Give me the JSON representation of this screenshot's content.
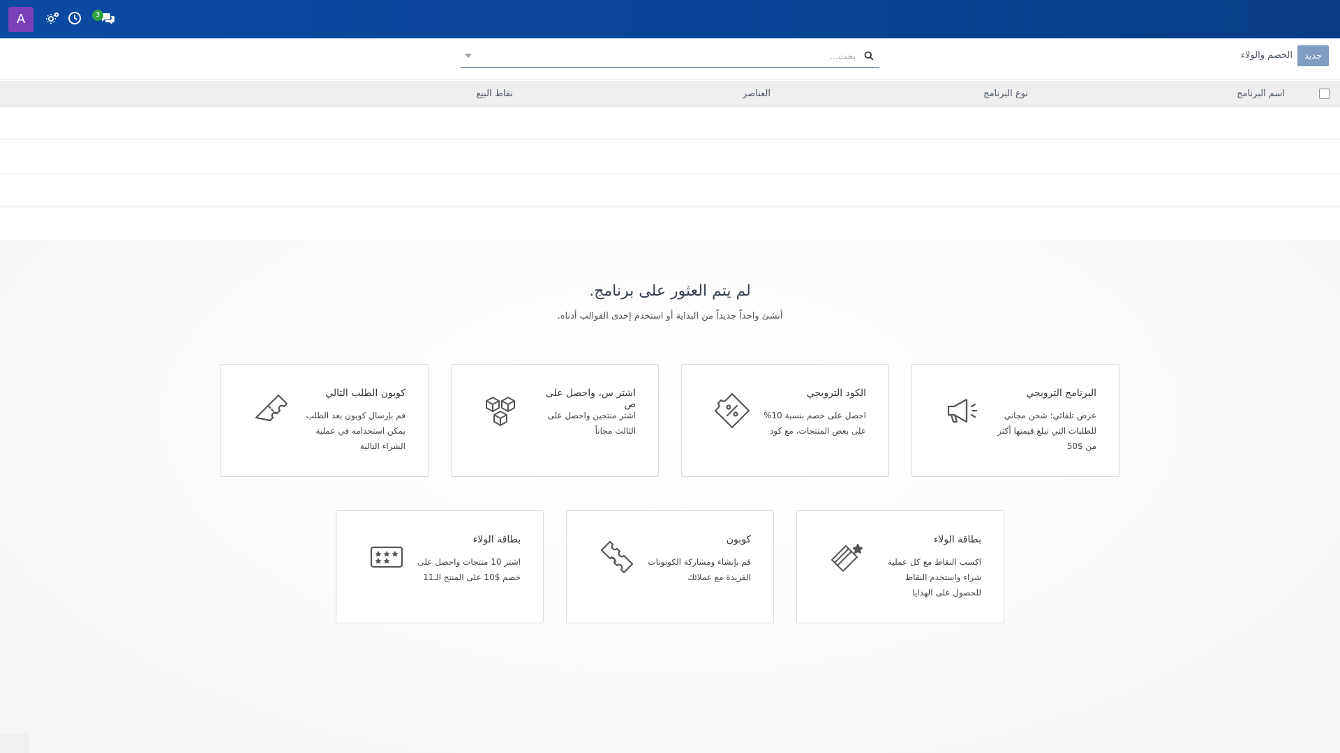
{
  "topbar": {
    "avatar_letter": "A",
    "chat_badge_count": "3",
    "icons": [
      "settings-icon",
      "clock-icon",
      "chat-icon"
    ]
  },
  "control": {
    "new_button": "جديد",
    "breadcrumb": "الخصم والولاء",
    "search_placeholder": "بحث..."
  },
  "list": {
    "columns": [
      "اسم البرنامج",
      "نوع البرنامج",
      "العناصر",
      "نقاط البيع"
    ]
  },
  "empty_state": {
    "title": "لم يتم العثور على برنامج.",
    "subtitle": "أنشئ واحداً جديداً من البداية أو استخدم إحدى القوالب أدناه."
  },
  "templates": [
    {
      "title": "البرنامج الترويجي",
      "description": "عرض تلقائي: شحن مجاني للطلبات التي تبلغ قيمتها أكثر من $50",
      "icon": "megaphone-icon"
    },
    {
      "title": "الكود الترويجي",
      "description": "احصل على خصم بنسبة 10% على بعض المنتجات، مع كود",
      "icon": "discount-tag-icon"
    },
    {
      "title": "اشتر س، واحصل على ص",
      "description": "اشتر منتجين واحصل على الثالث مجاناً",
      "icon": "boxes-icon"
    },
    {
      "title": "كوبون الطلب التالي",
      "description": "قم بإرسال كوبون بعد الطلب يمكن استخدامه في عملية الشراء التالية",
      "icon": "ticket-icon"
    },
    {
      "title": "بطاقة الولاء",
      "description": "اكسب النقاط مع كل عملية شراء واستخدم النقاط للحصول على الهدايا",
      "icon": "loyalty-card-icon"
    },
    {
      "title": "كوبون",
      "description": "قم بإنشاء ومشاركة الكوبونات الفريدة مع عملائك",
      "icon": "coupon-icon"
    },
    {
      "title": "بطاقة الولاء",
      "description": "اشتر 10 منتجات واحصل على خصم $10 على المنتج الـ11",
      "icon": "stamp-card-icon"
    }
  ],
  "colors": {
    "topbar": "#0a4597",
    "avatar": "#7b3fb8",
    "badge": "#2ea043",
    "new_button": "#7f9cc1"
  }
}
